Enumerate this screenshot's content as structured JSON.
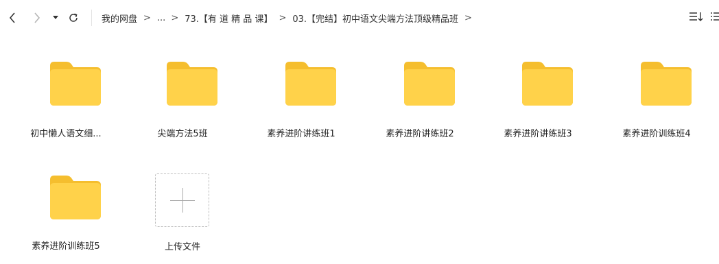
{
  "nav": {
    "back_icon": "back-arrow-icon",
    "forward_icon": "forward-arrow-icon",
    "dropdown_icon": "dropdown-caret-icon",
    "refresh_icon": "refresh-icon"
  },
  "breadcrumb": {
    "items": [
      "我的网盘",
      "...",
      "73.【有 道 精 品 课】",
      "03.【完结】初中语文尖端方法顶级精品班"
    ],
    "separator": ">"
  },
  "view_controls": {
    "sort_icon": "sort-list-icon",
    "list_view_icon": "list-view-icon"
  },
  "files": [
    {
      "name": "初中懒人语文细...",
      "type": "folder"
    },
    {
      "name": "尖端方法5班",
      "type": "folder"
    },
    {
      "name": "素养进阶讲练班1",
      "type": "folder"
    },
    {
      "name": "素养进阶讲练班2",
      "type": "folder"
    },
    {
      "name": "素养进阶讲练班3",
      "type": "folder"
    },
    {
      "name": "素养进阶训练班4",
      "type": "folder"
    },
    {
      "name": "素养进阶训练班5",
      "type": "folder"
    }
  ],
  "upload": {
    "label": "上传文件",
    "icon": "plus-icon"
  },
  "colors": {
    "folder_body": "#FFD24A",
    "folder_tab": "#F5BE2E",
    "text": "#222222",
    "separator": "#e3e3e3"
  }
}
